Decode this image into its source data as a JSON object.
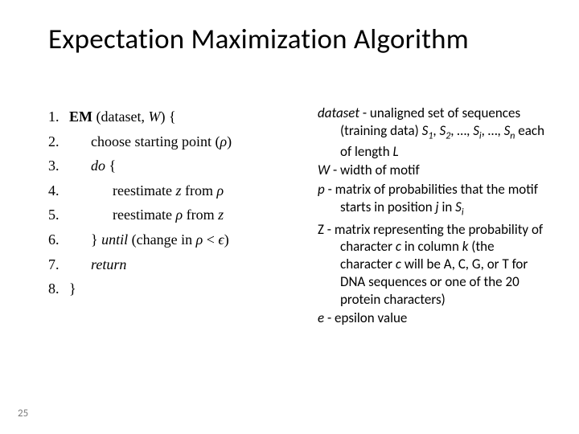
{
  "title": "Expectation Maximization Algorithm",
  "algo": {
    "lines": [
      {
        "n": "1.",
        "indent": 0,
        "html": "<b>EM</b> (dataset, <span class=\"mathvar\">W</span>) {"
      },
      {
        "n": "2.",
        "indent": 2,
        "html": "choose starting point (<span class=\"mathvar\">ρ</span>)"
      },
      {
        "n": "3.",
        "indent": 2,
        "html": "<span class=\"mathvar\">do</span> {"
      },
      {
        "n": "4.",
        "indent": 4,
        "html": "reestimate <span class=\"mathvar\">z</span> from <span class=\"mathvar\">ρ</span>"
      },
      {
        "n": "5.",
        "indent": 4,
        "html": "reestimate <span class=\"mathvar\">ρ</span> from <span class=\"mathvar\">z</span>"
      },
      {
        "n": "6.",
        "indent": 2,
        "html": "} <span class=\"mathvar\">until</span> (change in <span class=\"mathvar\">ρ</span> &lt; <span class=\"mathvar\">ϵ</span>)"
      },
      {
        "n": "7.",
        "indent": 2,
        "html": "<span class=\"mathvar\">return</span>"
      },
      {
        "n": "8.",
        "indent": 0,
        "html": "}"
      }
    ]
  },
  "defs": [
    {
      "term": "dataset",
      "termClass": "term-italic",
      "descHtml": " - unaligned set of sequences (training data) <span class=\"mathvar\">S</span><span class=\"sub\">1</span>, <span class=\"mathvar\">S</span><span class=\"sub\">2</span>, …, <span class=\"mathvar\">S</span><span class=\"sub\">i</span>, …, <span class=\"mathvar\">S</span><span class=\"sub\">n</span>  each of length <span class=\"mathvar\">L</span>"
    },
    {
      "term": "W",
      "termClass": "term-italic",
      "descHtml": " - width of motif"
    },
    {
      "term": "p",
      "termClass": "term-italic",
      "descHtml": " - matrix of probabilities that the motif starts in position <span class=\"mathvar\">j</span> in <span class=\"mathvar\">S</span><span class=\"sub\">i</span>"
    },
    {
      "term": "Z",
      "termClass": "term-upright",
      "descHtml": " - matrix representing the probability of character <span class=\"mathvar\">c</span> in column <span class=\"mathvar\">k</span> (the character <span class=\"mathvar\">c</span> will be A, C, G, or T for DNA sequences or one of the 20 protein characters)"
    },
    {
      "term": "e",
      "termClass": "term-italic",
      "descHtml": " - epsilon value"
    }
  ],
  "pageNumber": "25"
}
